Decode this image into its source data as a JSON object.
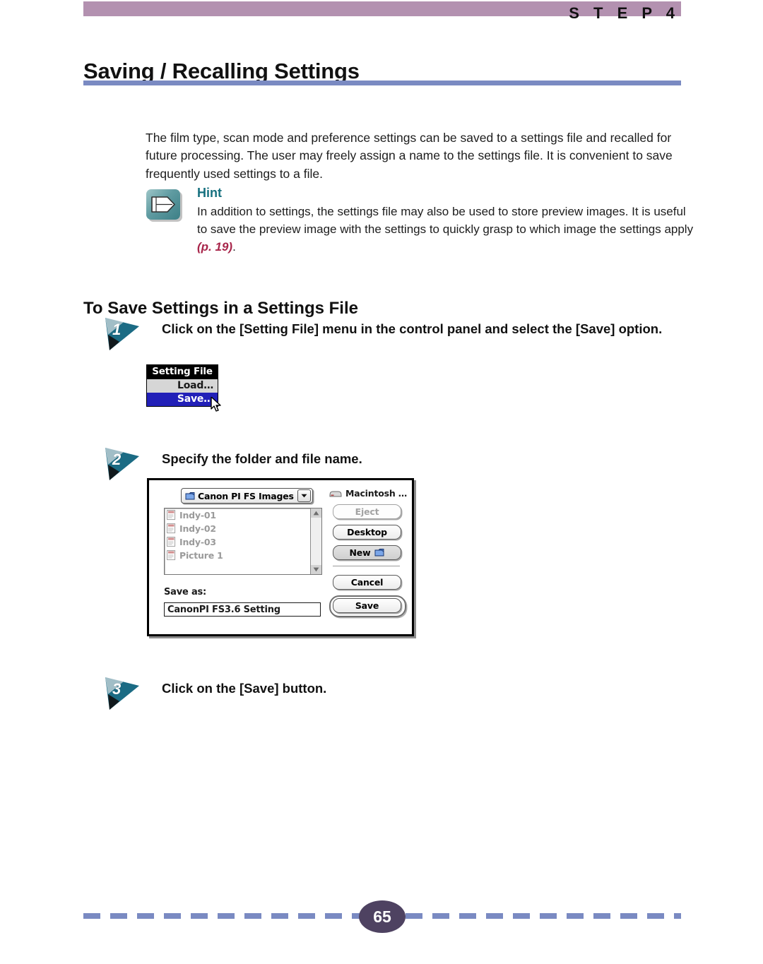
{
  "header": {
    "step_label": "S T E P   4",
    "title": "Saving / Recalling Settings"
  },
  "intro": "The film type, scan mode and preference settings can be saved to a settings file and recalled for future processing. The user may freely assign a name to the settings file. It is convenient to save frequently used settings to a file.",
  "hint": {
    "icon": "pencil-hint-icon",
    "title": "Hint",
    "body_before": "In addition to settings, the settings file may also be used to store preview images. It is useful to save the preview image with the settings to quickly grasp to which image the settings apply ",
    "page_ref": "(p. 19)",
    "body_after": "."
  },
  "section": {
    "heading": "To Save Settings in a Settings File"
  },
  "steps": [
    {
      "number": "1",
      "text": "Click on the [Setting File] menu in the control panel and select the [Save] option."
    },
    {
      "number": "2",
      "text": "Specify the folder and file name."
    },
    {
      "number": "3",
      "text": "Click on the [Save] button."
    }
  ],
  "setting_file_menu": {
    "title": "Setting File",
    "items": [
      {
        "label": "Load…",
        "selected": false
      },
      {
        "label": "Save…",
        "selected": true
      }
    ],
    "cursor": "arrow-cursor"
  },
  "save_dialog": {
    "location_popup": {
      "icon": "folder-icon",
      "label": "Canon PI FS Images",
      "arrow": "chevron-down-icon"
    },
    "files": [
      {
        "name": "Indy-01",
        "icon": "document-icon"
      },
      {
        "name": "Indy-02",
        "icon": "document-icon"
      },
      {
        "name": "Indy-03",
        "icon": "document-icon"
      },
      {
        "name": "Picture 1",
        "icon": "document-icon"
      }
    ],
    "drive": {
      "icon": "hard-drive-icon",
      "label": "Macintosh …"
    },
    "buttons": [
      {
        "label": "Eject",
        "state": "disabled"
      },
      {
        "label": "Desktop",
        "state": "enabled"
      },
      {
        "label": "New",
        "state": "enabled",
        "icon": "new-folder-icon"
      },
      {
        "label": "Cancel",
        "state": "enabled"
      },
      {
        "label": "Save",
        "state": "default"
      }
    ],
    "save_as_label": "Save as:",
    "save_as_value": "CanonPI FS3.6 Setting"
  },
  "footer": {
    "page_number": "65"
  },
  "colors": {
    "header_bar": "#b391b0",
    "rule": "#7a8ac2",
    "hint_title": "#16707f",
    "page_ref": "#a8254a",
    "step_badge": "#1b6b84",
    "page_bubble": "#4e4261",
    "menu_selection": "#2220b8"
  }
}
